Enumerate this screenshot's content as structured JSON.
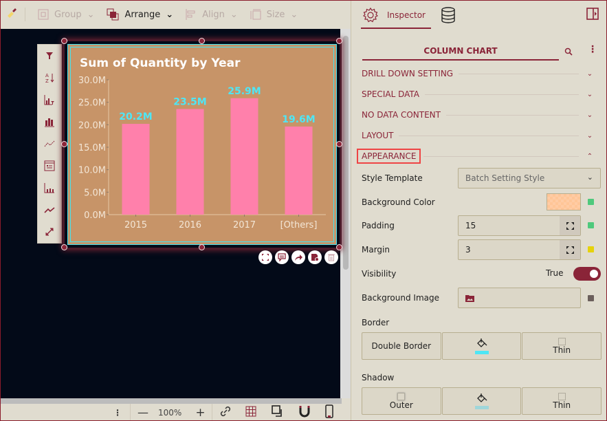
{
  "toolbar": {
    "group_label": "Group",
    "arrange_label": "Arrange",
    "align_label": "Align",
    "size_label": "Size"
  },
  "inspector": {
    "tab_inspector": "Inspector",
    "section_title": "COLUMN CHART",
    "accordions": [
      {
        "label": "DRILL DOWN SETTING",
        "expanded": false
      },
      {
        "label": "SPECIAL DATA",
        "expanded": false
      },
      {
        "label": "NO DATA CONTENT",
        "expanded": false
      },
      {
        "label": "LAYOUT",
        "expanded": false
      },
      {
        "label": "APPEARANCE",
        "expanded": true
      }
    ],
    "appearance": {
      "style_template_label": "Style Template",
      "style_template_value": "Batch Setting Style",
      "background_color_label": "Background Color",
      "background_color_value": "#ffc597",
      "padding_label": "Padding",
      "padding_value": "15",
      "margin_label": "Margin",
      "margin_value": "3",
      "visibility_label": "Visibility",
      "visibility_value": "True",
      "background_image_label": "Background Image",
      "border_label": "Border",
      "border_style": "Double Border",
      "border_color": "#4ee6f5",
      "border_width": "Thin",
      "shadow_label": "Shadow",
      "shadow_type": "Outer",
      "shadow_color": "#9fd6da",
      "shadow_width": "Thin"
    },
    "status_colors": {
      "background_color": "#4fc97c",
      "padding": "#4fc97c",
      "margin": "#e6d20c",
      "background_image": "#6b5f5c"
    }
  },
  "bottombar": {
    "zoom_level": "100%"
  },
  "chart_data": {
    "type": "bar",
    "title": "Sum of Quantity by Year",
    "categories": [
      "2015",
      "2016",
      "2017",
      "[Others]"
    ],
    "values": [
      20.2,
      23.5,
      25.9,
      19.6
    ],
    "data_labels": [
      "20.2M",
      "23.5M",
      "25.9M",
      "19.6M"
    ],
    "unit": "M",
    "yticks": [
      "0.0M",
      "5.0M",
      "10.0M",
      "15.0M",
      "20.0M",
      "25.0M",
      "30.0M"
    ],
    "ylim": [
      0,
      30
    ],
    "xlabel": "",
    "ylabel": "",
    "bar_color": "#ff80ab",
    "label_color": "#4ee6f5",
    "background": "#c79468",
    "grid": false
  }
}
